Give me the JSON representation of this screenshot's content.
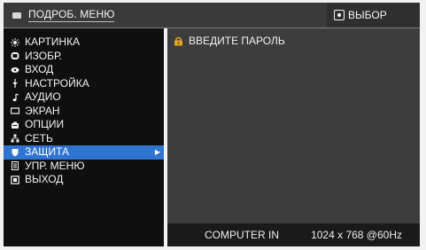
{
  "header": {
    "menu_title": "ПОДРОБ. МЕНЮ",
    "select_hint": "ВЫБОР"
  },
  "menu": {
    "items": [
      {
        "label": "КАРТИНКА",
        "icon": "sun-icon"
      },
      {
        "label": "ИЗОБР.",
        "icon": "picture-icon"
      },
      {
        "label": "ВХОД",
        "icon": "input-icon"
      },
      {
        "label": "НАСТРОЙКА",
        "icon": "setup-icon"
      },
      {
        "label": "АУДИО",
        "icon": "audio-icon"
      },
      {
        "label": "ЭКРАН",
        "icon": "screen-icon"
      },
      {
        "label": "ОПЦИИ",
        "icon": "options-icon"
      },
      {
        "label": "СЕТЬ",
        "icon": "network-icon"
      },
      {
        "label": "ЗАЩИТА",
        "icon": "shield-icon",
        "selected": true
      },
      {
        "label": "УПР. МЕНЮ",
        "icon": "menu-control-icon"
      },
      {
        "label": "ВЫХОД",
        "icon": "exit-icon"
      }
    ]
  },
  "panel": {
    "password_label": "ВВЕДИТЕ ПАРОЛЬ"
  },
  "status": {
    "source": "COMPUTER IN",
    "resolution": "1024 x 768 @60Hz"
  },
  "colors": {
    "header_bg": "#3a3a3a",
    "left_bg": "#0f0f0f",
    "right_bg": "#3d3d3d",
    "status_bg": "#1a1a1a",
    "selected_bg": "#2f74d0",
    "lock_accent": "#e3a522"
  }
}
